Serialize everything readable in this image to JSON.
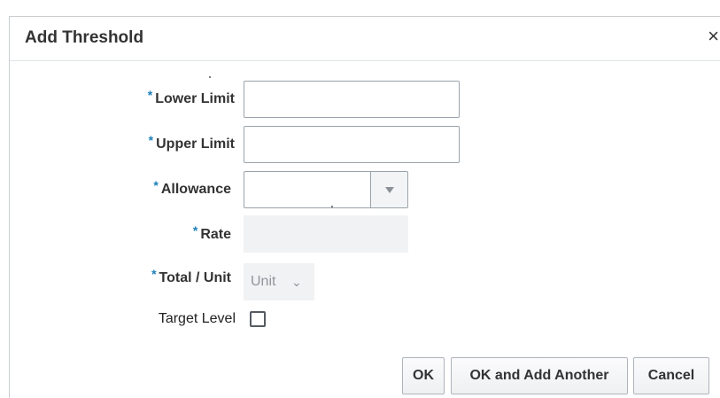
{
  "dialog": {
    "title": "Add Threshold",
    "close_glyph": "×"
  },
  "form": {
    "required_marker": "*",
    "lower_limit": {
      "label": "Lower Limit",
      "value": ""
    },
    "upper_limit": {
      "label": "Upper Limit",
      "value": ""
    },
    "allowance": {
      "label": "Allowance",
      "selected": ""
    },
    "rate": {
      "label": "Rate",
      "value": ""
    },
    "total_unit": {
      "label": "Total / Unit",
      "selected": "Unit",
      "chevron": "⌄"
    },
    "target_level": {
      "label": "Target Level",
      "checked": false
    }
  },
  "buttons": {
    "ok": "OK",
    "ok_add_another": "OK and Add Another",
    "cancel": "Cancel"
  },
  "icons": {
    "close": "close-icon",
    "dropdown": "triangle-down-icon",
    "chevron": "chevron-down-icon"
  },
  "colors": {
    "required_marker": "#1b7fb9",
    "text": "#333333",
    "readonly_bg": "#f1f2f3"
  }
}
